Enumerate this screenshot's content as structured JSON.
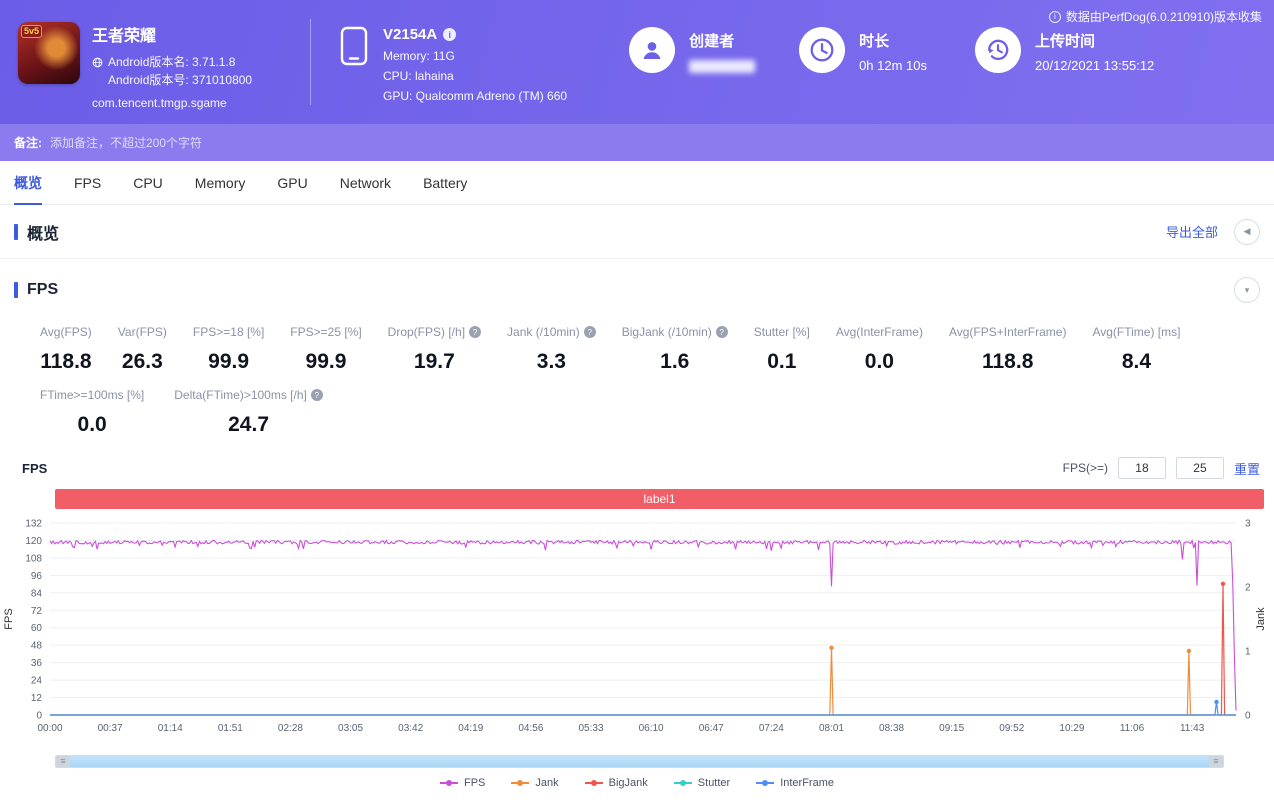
{
  "meta": {
    "source_note": "数据由PerfDog(6.0.210910)版本收集"
  },
  "header": {
    "app": {
      "name": "王者荣耀",
      "badge": "5v5",
      "android_version": "Android版本名: 3.71.1.8",
      "android_build": "Android版本号: 371010800",
      "package": "com.tencent.tmgp.sgame"
    },
    "device": {
      "model": "V2154A",
      "memory": "Memory: 11G",
      "cpu": "CPU: lahaina",
      "gpu": "GPU: Qualcomm Adreno (TM) 660"
    },
    "creator": {
      "label": "创建者"
    },
    "duration": {
      "label": "时长",
      "value": "0h 12m 10s"
    },
    "upload": {
      "label": "上传时间",
      "value": "20/12/2021 13:55:12"
    }
  },
  "remarks": {
    "label": "备注:",
    "placeholder": "添加备注，不超过200个字符"
  },
  "tabs": {
    "active": 0,
    "items": [
      {
        "id": "overview",
        "label": "概览"
      },
      {
        "id": "fps",
        "label": "FPS"
      },
      {
        "id": "cpu",
        "label": "CPU"
      },
      {
        "id": "memory",
        "label": "Memory"
      },
      {
        "id": "gpu",
        "label": "GPU"
      },
      {
        "id": "network",
        "label": "Network"
      },
      {
        "id": "battery",
        "label": "Battery"
      }
    ]
  },
  "overview": {
    "title": "概览",
    "export_all": "导出全部"
  },
  "fps": {
    "title": "FPS",
    "chart_label": "FPS",
    "controls": {
      "label": "FPS(>=)",
      "threshold1": "18",
      "threshold2": "25",
      "reset": "重置"
    },
    "metrics_row1": [
      {
        "id": "avg-fps",
        "label": "Avg(FPS)",
        "value": "118.8",
        "info": false
      },
      {
        "id": "var-fps",
        "label": "Var(FPS)",
        "value": "26.3",
        "info": false
      },
      {
        "id": "fps-ge-18",
        "label": "FPS>=18 [%]",
        "value": "99.9",
        "info": false
      },
      {
        "id": "fps-ge-25",
        "label": "FPS>=25 [%]",
        "value": "99.9",
        "info": false
      },
      {
        "id": "drop-fps",
        "label": "Drop(FPS) [/h]",
        "value": "19.7",
        "info": true
      },
      {
        "id": "jank",
        "label": "Jank (/10min)",
        "value": "3.3",
        "info": true
      },
      {
        "id": "bigjank",
        "label": "BigJank (/10min)",
        "value": "1.6",
        "info": true
      },
      {
        "id": "stutter",
        "label": "Stutter [%]",
        "value": "0.1",
        "info": false
      },
      {
        "id": "avg-interframe",
        "label": "Avg(InterFrame)",
        "value": "0.0",
        "info": false
      },
      {
        "id": "avg-fps-interframe",
        "label": "Avg(FPS+InterFrame)",
        "value": "118.8",
        "info": false
      },
      {
        "id": "avg-ftime",
        "label": "Avg(FTime) [ms]",
        "value": "8.4",
        "info": false
      }
    ],
    "metrics_row2": [
      {
        "id": "ftime-ge-100ms",
        "label": "FTime>=100ms [%]",
        "value": "0.0",
        "info": false
      },
      {
        "id": "delta-ftime",
        "label": "Delta(FTime)>100ms [/h]",
        "value": "24.7",
        "info": true
      }
    ]
  },
  "chart_data": {
    "type": "line",
    "banner": "label1",
    "x_axis": {
      "ticks": [
        "00:00",
        "00:37",
        "01:14",
        "01:51",
        "02:28",
        "03:05",
        "03:42",
        "04:19",
        "04:56",
        "05:33",
        "06:10",
        "06:47",
        "07:24",
        "08:01",
        "08:38",
        "09:15",
        "09:52",
        "10:29",
        "11:06",
        "11:43"
      ],
      "tick_interval_seconds": 37,
      "duration_seconds": 730
    },
    "y_left": {
      "name": "FPS",
      "min": 0,
      "max": 132,
      "step": 12
    },
    "y_right": {
      "name": "Jank",
      "min": 0,
      "max": 3,
      "step": 1
    },
    "grid": true,
    "legend_position": "bottom",
    "series": [
      {
        "id": "fps",
        "name": "FPS",
        "color": "#c94fd6",
        "axis": "left",
        "baseline": 118.8,
        "noise": 2.4,
        "dip_chance": 0.07,
        "dip_depth": 5.5,
        "dips": [
          {
            "t": 481,
            "v": 88.5
          },
          {
            "t": 697,
            "v": 107
          },
          {
            "t": 706,
            "v": 89
          },
          {
            "t": 728,
            "v": 90
          },
          {
            "t": 729,
            "v": 40
          },
          {
            "t": 730,
            "v": 3
          }
        ]
      },
      {
        "id": "jank",
        "name": "Jank",
        "color": "#f08c3c",
        "axis": "right",
        "baseline": 0,
        "spikes": [
          {
            "t": 481,
            "v": 1.05
          },
          {
            "t": 701,
            "v": 1.0
          }
        ]
      },
      {
        "id": "bigjank",
        "name": "BigJank",
        "color": "#ee574e",
        "axis": "right",
        "baseline": 0,
        "spikes": [
          {
            "t": 722,
            "v": 2.05
          }
        ]
      },
      {
        "id": "stutter",
        "name": "Stutter",
        "color": "#35cec8",
        "axis": "right",
        "baseline": 0,
        "spikes": []
      },
      {
        "id": "interframe",
        "name": "InterFrame",
        "color": "#4f8ef5",
        "axis": "left",
        "baseline": 0,
        "spikes": [
          {
            "t": 718,
            "v": 9
          }
        ]
      }
    ]
  }
}
